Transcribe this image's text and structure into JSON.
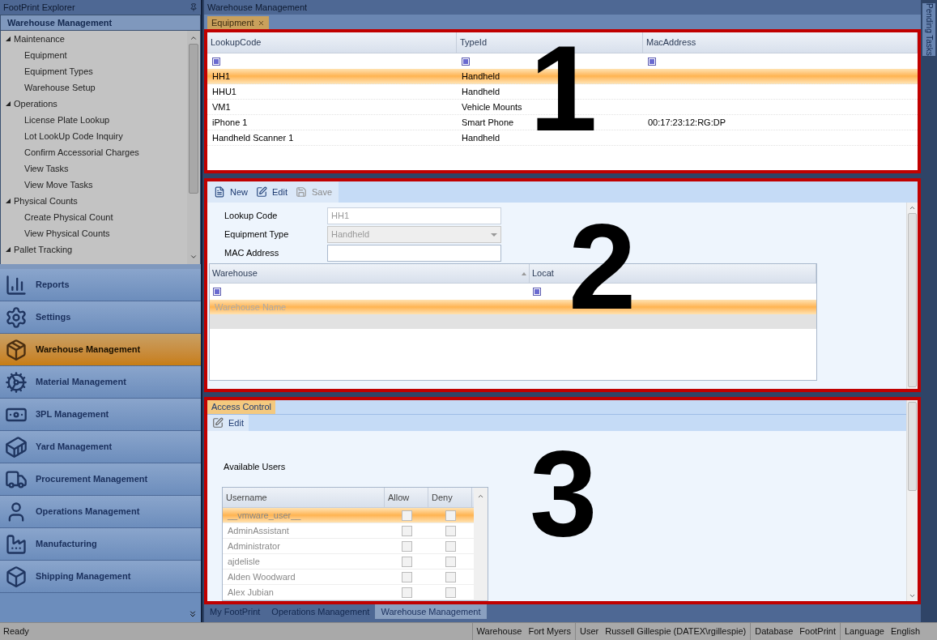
{
  "explorer": {
    "title": "FootPrint Explorer",
    "header": "Warehouse Management",
    "tree": [
      {
        "label": "Maintenance",
        "expanded": true,
        "children": [
          {
            "label": "Equipment"
          },
          {
            "label": "Equipment Types"
          },
          {
            "label": "Warehouse Setup"
          }
        ]
      },
      {
        "label": "Operations",
        "expanded": true,
        "children": [
          {
            "label": "License Plate Lookup"
          },
          {
            "label": "Lot LookUp Code Inquiry"
          },
          {
            "label": "Confirm Accessorial Charges"
          },
          {
            "label": "View Tasks"
          },
          {
            "label": "View Move Tasks"
          }
        ]
      },
      {
        "label": "Physical Counts",
        "expanded": true,
        "children": [
          {
            "label": "Create Physical Count"
          },
          {
            "label": "View Physical Counts"
          }
        ]
      },
      {
        "label": "Pallet Tracking",
        "expanded": true
      }
    ],
    "nav": [
      {
        "label": "Reports",
        "selected": false
      },
      {
        "label": "Settings",
        "selected": false
      },
      {
        "label": "Warehouse Management",
        "selected": true
      },
      {
        "label": "Material Management",
        "selected": false
      },
      {
        "label": "3PL Management",
        "selected": false
      },
      {
        "label": "Yard Management",
        "selected": false
      },
      {
        "label": "Procurement Management",
        "selected": false
      },
      {
        "label": "Operations Management",
        "selected": false
      },
      {
        "label": "Manufacturing",
        "selected": false
      },
      {
        "label": "Shipping Management",
        "selected": false
      }
    ]
  },
  "workspace": {
    "title": "Warehouse Management",
    "tabs": [
      {
        "label": "Equipment",
        "selected": true
      }
    ],
    "equipment_grid": {
      "callout": "1",
      "columns": [
        "LookupCode",
        "TypeId",
        "MacAddress"
      ],
      "rows": [
        {
          "cells": [
            "HH1",
            "Handheld",
            ""
          ],
          "selected": true
        },
        {
          "cells": [
            "HHU1",
            "Handheld",
            ""
          ],
          "selected": false
        },
        {
          "cells": [
            "VM1",
            "Vehicle Mounts",
            ""
          ],
          "selected": false
        },
        {
          "cells": [
            "iPhone 1",
            "Smart Phone",
            "00:17:23:12:RG:DP"
          ],
          "selected": false
        },
        {
          "cells": [
            "Handheld Scanner 1",
            "Handheld",
            ""
          ],
          "selected": false
        }
      ]
    },
    "detail": {
      "callout": "2",
      "toolbar": [
        {
          "label": "New",
          "disabled": false
        },
        {
          "label": "Edit",
          "disabled": false
        },
        {
          "label": "Save",
          "disabled": true
        }
      ],
      "fields": [
        {
          "label": "Lookup Code",
          "kind": "text",
          "value": "HH1",
          "disabled": true
        },
        {
          "label": "Equipment Type",
          "kind": "dropdown",
          "value": "Handheld",
          "disabled": true
        },
        {
          "label": "MAC Address",
          "kind": "text",
          "disabled": false
        }
      ],
      "grid": {
        "columns": [
          "Warehouse",
          "Locat"
        ],
        "rows": [
          {
            "cells": [
              "Warehouse Name"
            ],
            "selected": true
          }
        ]
      }
    },
    "access": {
      "callout": "3",
      "tab": "Access Control",
      "toolbar": [
        "Edit"
      ],
      "caption": "Available Users",
      "columns": [
        "Username",
        "Allow",
        "Deny"
      ],
      "users": [
        {
          "name": "__vmware_user__",
          "allow": false,
          "deny": false,
          "selected": true
        },
        {
          "name": "AdminAssistant",
          "allow": false,
          "deny": false,
          "selected": false
        },
        {
          "name": "Administrator",
          "allow": false,
          "deny": false,
          "selected": false
        },
        {
          "name": "ajdelisle",
          "allow": false,
          "deny": false,
          "selected": false
        },
        {
          "name": "Alden Woodward",
          "allow": false,
          "deny": false,
          "selected": false
        },
        {
          "name": "Alex Jubian",
          "allow": false,
          "deny": false,
          "selected": false
        }
      ]
    },
    "bottom_tabs": [
      {
        "label": "My FootPrint",
        "selected": false
      },
      {
        "label": "Operations Management",
        "selected": false
      },
      {
        "label": "Warehouse Management",
        "selected": true
      }
    ]
  },
  "side_tab": "Pending Tasks",
  "status_bar": {
    "message": "Ready",
    "items": [
      {
        "label": "Warehouse",
        "value": "Fort Myers"
      },
      {
        "label": "User",
        "value": "Russell Gillespie (DATEX\\rgillespie)"
      },
      {
        "label": "Database",
        "value": "FootPrint"
      },
      {
        "label": "Language",
        "value": "English"
      }
    ]
  }
}
